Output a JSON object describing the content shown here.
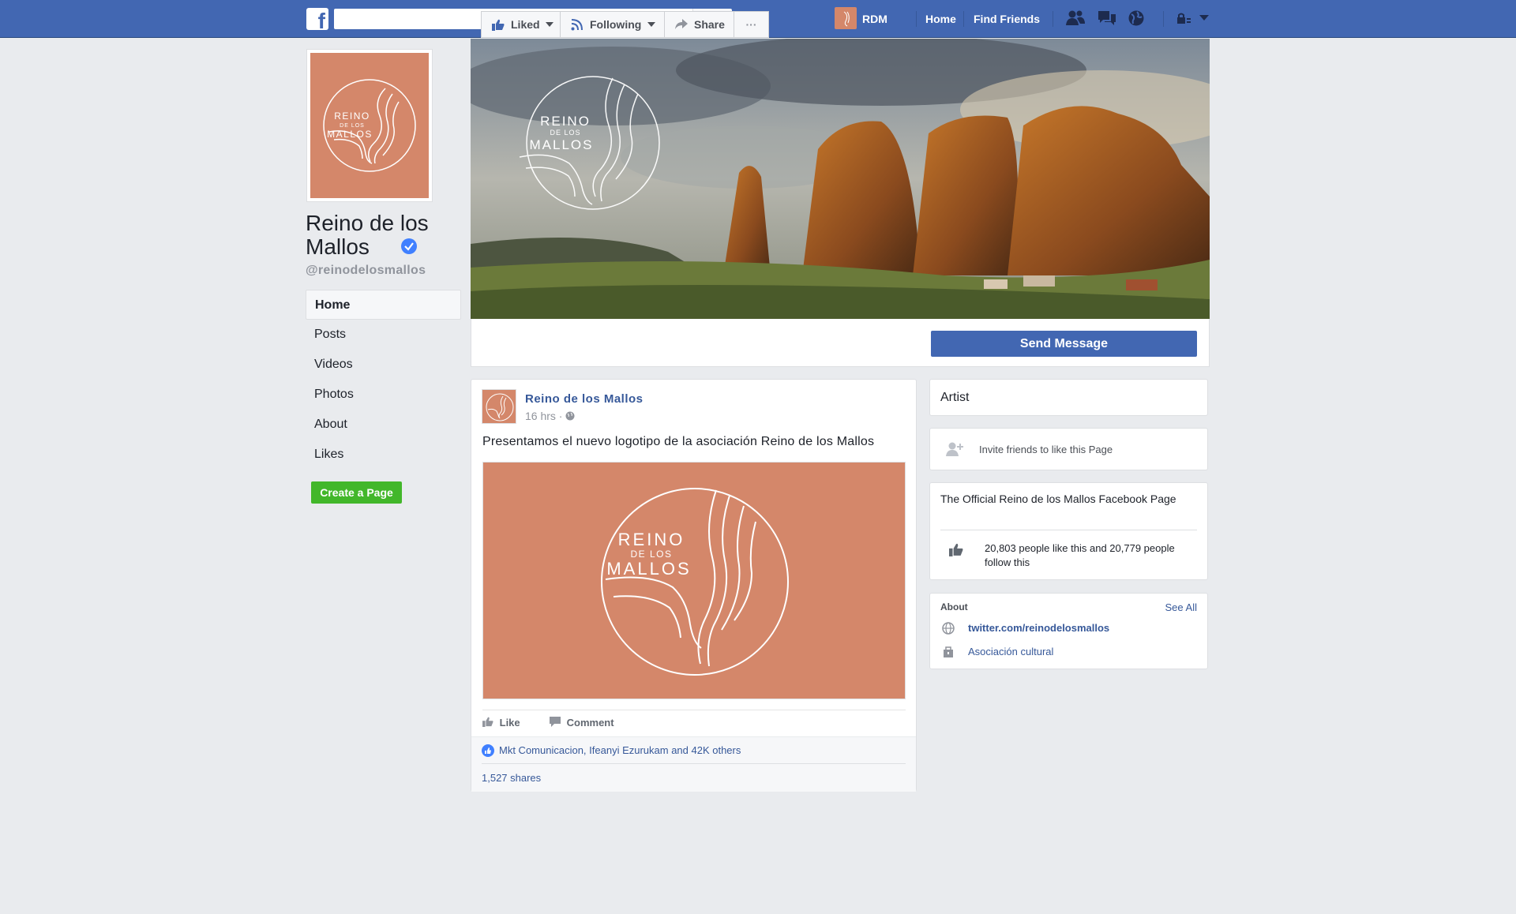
{
  "topbar": {
    "search_placeholder": "",
    "user_name": "RDM",
    "links": [
      "Home",
      "Find Friends"
    ]
  },
  "page": {
    "name": "Reino de los Mallos",
    "handle": "@reinodelosmallos",
    "logo_text": [
      "REINO",
      "DE LOS",
      "MALLOS"
    ]
  },
  "left_nav": [
    "Home",
    "Posts",
    "Videos",
    "Photos",
    "About",
    "Likes"
  ],
  "create_page_label": "Create a Page",
  "actions": {
    "liked": "Liked",
    "following": "Following",
    "share": "Share",
    "more": "···",
    "send_message": "Send Message"
  },
  "post": {
    "author": "Reino de los Mallos",
    "time": "16 hrs ·",
    "text": "Presentamos el nuevo logotipo de la asociación Reino de los Mallos",
    "like": "Like",
    "comment": "Comment",
    "likes_summary": "Mkt Comunicacion, Ifeanyi Ezurukam and 42K others",
    "shares": "1,527 shares"
  },
  "sidebar": {
    "category": "Artist",
    "invite": "Invite friends to like this Page",
    "description": "The Official Reino de los Mallos Facebook Page",
    "stats": "20,803 people like this and 20,779 people follow this",
    "about_header": "About",
    "see_all": "See All",
    "twitter": "twitter.com/reinodelosmallos",
    "category_link": "Asociación cultural"
  },
  "colors": {
    "brand_blue": "#4267b2",
    "logo_salmon": "#d4876a",
    "link_blue": "#365899",
    "green": "#42b72a",
    "background": "#e9ebee"
  }
}
